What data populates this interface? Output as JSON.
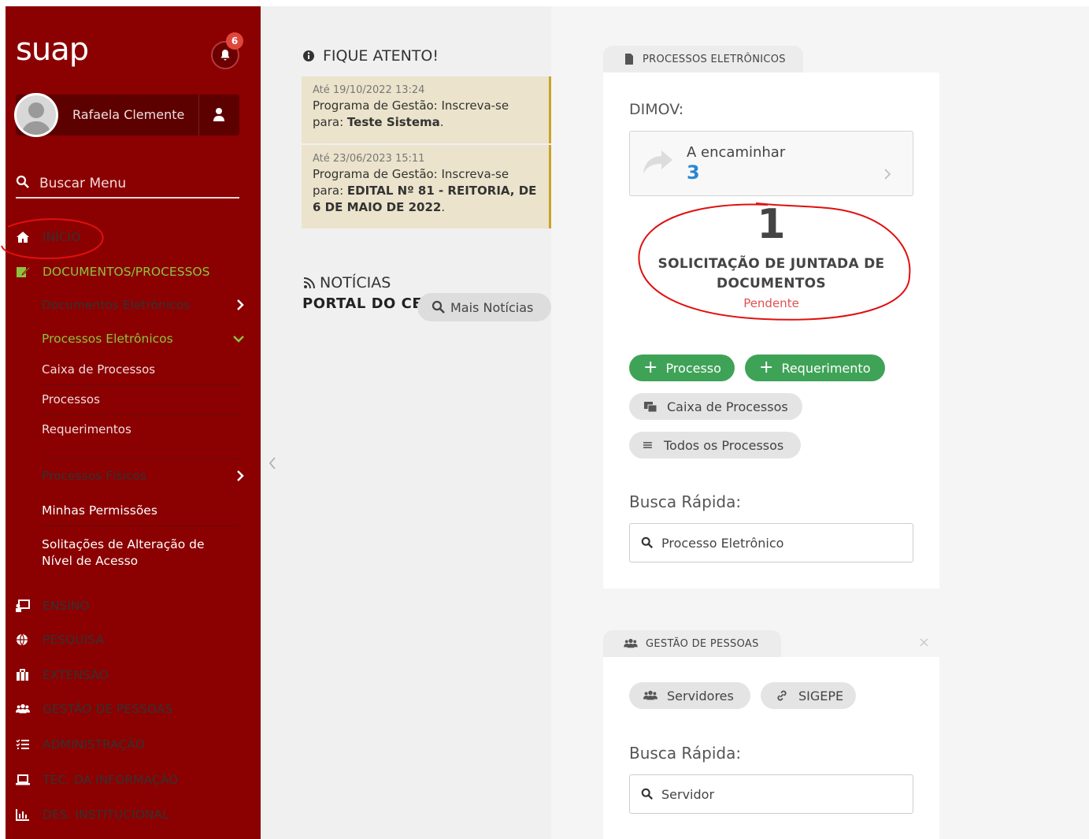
{
  "sidebar": {
    "logo": "suap",
    "notifications_count": "6",
    "user_name": "Rafaela Clemente",
    "search_placeholder": "Buscar Menu",
    "inicio": "INÍCIO",
    "documentos_processos": "DOCUMENTOS/PROCESSOS",
    "documentos_eletronicos": "Documentos Eletrônicos",
    "processos_eletronicos": "Processos Eletrônicos",
    "caixa_de_processos": "Caixa de Processos",
    "processos": "Processos",
    "requerimentos": "Requerimentos",
    "processos_fisicos": "Processos Físicos",
    "minhas_permissoes": "Minhas Permissões",
    "solicitacoes_alteracao_line1": "Solitações de Alteração de",
    "solicitacoes_alteracao_line2": "Nível de Acesso",
    "ensino": "ENSINO",
    "pesquisa": "PESQUISA",
    "extensao": "EXTENSÃO",
    "gestao_de_pessoas": "GESTÃO DE PESSOAS",
    "administracao": "ADMINISTRAÇÃO",
    "tec_informacao": "TEC. DA INFORMAÇÃO",
    "des_institucional": "DES. INSTITUCIONAL"
  },
  "fique_atento": {
    "title": "FIQUE ATENTO!",
    "notices": [
      {
        "date": "Até 19/10/2022 13:24",
        "text_prefix": "Programa de Gestão: Inscreva-se para: ",
        "text_bold": "Teste Sistema",
        "text_suffix": "."
      },
      {
        "date": "Até 23/06/2023 15:11",
        "text_prefix": "Programa de Gestão: Inscreva-se para: ",
        "text_bold": "EDITAL Nº 81 - REITORIA, DE 6 DE MAIO DE 2022",
        "text_suffix": "."
      }
    ]
  },
  "noticias": {
    "title": "NOTÍCIAS",
    "portal": "PORTAL DO CEFET-RJ",
    "mais_noticias": "Mais Notícias"
  },
  "processos_eletronicos": {
    "tab_label": "PROCESSOS ELETRÔNICOS",
    "section": "DIMOV:",
    "encaminhar_label": "A encaminhar",
    "encaminhar_count": "3",
    "solicitacao_count": "1",
    "solicitacao_line1": "SOLICITAÇÃO DE JUNTADA DE",
    "solicitacao_line2": "DOCUMENTOS",
    "solicitacao_status": "Pendente",
    "btn_processo": "Processo",
    "btn_requerimento": "Requerimento",
    "btn_caixa": "Caixa de Processos",
    "btn_todos": "Todos os Processos",
    "busca_label": "Busca Rápida:",
    "busca_placeholder": "Processo Eletrônico"
  },
  "gestao_pessoas": {
    "tab_label": "GESTÃO DE PESSOAS",
    "btn_servidores": "Servidores",
    "btn_sigepe": "SIGEPE",
    "busca_label": "Busca Rápida:",
    "busca_placeholder": "Servidor",
    "close": "×"
  },
  "colors": {
    "sidebar_bg": "#8b0000",
    "accent_green": "#8fc240",
    "button_green": "#3fa357",
    "count_blue": "#2b87d1",
    "pending_red": "#e05050"
  }
}
